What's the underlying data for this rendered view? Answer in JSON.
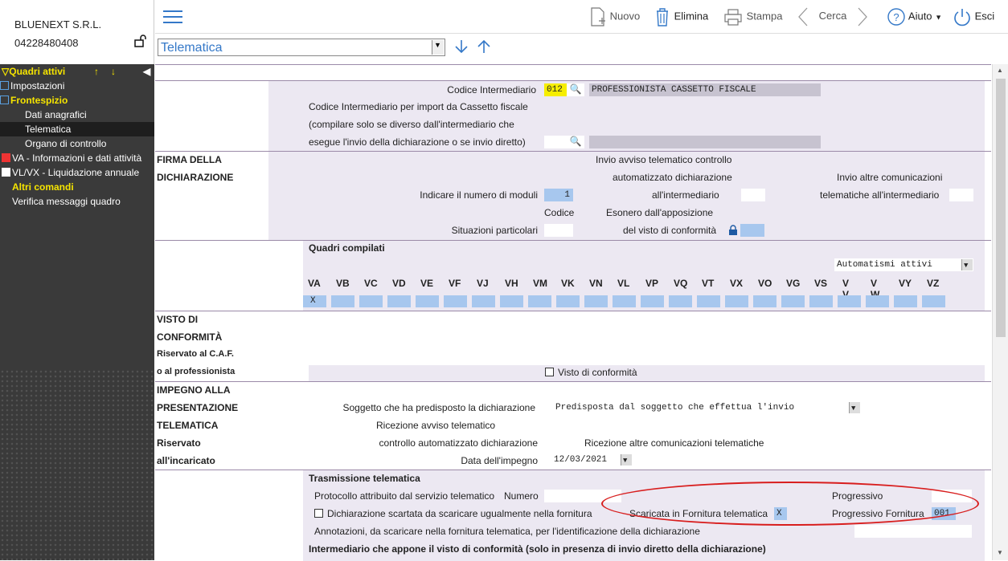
{
  "company": {
    "name": "BLUENEXT S.R.L.",
    "vat": "04228480408"
  },
  "toolbar": {
    "nuovo": "Nuovo",
    "elimina": "Elimina",
    "stampa": "Stampa",
    "cerca": "Cerca",
    "aiuto": "Aiuto",
    "esci": "Esci"
  },
  "combo": {
    "value": "Telematica"
  },
  "sidebar": {
    "header": "Quadri attivi",
    "items": [
      {
        "label": "Impostazioni"
      },
      {
        "label": "Frontespizio"
      },
      {
        "label": "Dati anagrafici"
      },
      {
        "label": "Telematica"
      },
      {
        "label": "Organo di controllo"
      },
      {
        "label": "VA - Informazioni e dati attività"
      },
      {
        "label": "VL/VX - Liquidazione annuale"
      }
    ],
    "altri": "Altri comandi",
    "verifica": "Verifica messaggi quadro"
  },
  "intermediario": {
    "codice_label": "Codice Intermediario",
    "codice_value": "012",
    "codice_desc": "PROFESSIONISTA CASSETTO FISCALE",
    "import_l1": "Codice Intermediario per import da Cassetto fiscale",
    "import_l2": "(compilare solo se diverso dall'intermediario che",
    "import_l3": "esegue l'invio della dichiarazione o se invio diretto)"
  },
  "firma": {
    "title1": "FIRMA DELLA",
    "title2": "DICHIARAZIONE",
    "moduli_label": "Indicare il numero di moduli",
    "moduli_value": "1",
    "codice": "Codice",
    "situazioni": "Situazioni particolari",
    "avviso1": "Invio avviso telematico controllo",
    "avviso2": "automatizzato dichiarazione",
    "avviso3": "all'intermediario",
    "esonero1": "Esonero dall'apposizione",
    "esonero2": "del visto di conformità",
    "altre1": "Invio altre comunicazioni",
    "altre2": "telematiche all'intermediario"
  },
  "quadri": {
    "title": "Quadri compilati",
    "automatismi": "Automatismi attivi",
    "codes": [
      "VA",
      "VB",
      "VC",
      "VD",
      "VE",
      "VF",
      "VJ",
      "VH",
      "VM",
      "VK",
      "VN",
      "VL",
      "VP",
      "VQ",
      "VT",
      "VX",
      "VO",
      "VG",
      "VS",
      "V V",
      "V W",
      "VY",
      "VZ"
    ],
    "va_value": "X"
  },
  "visto": {
    "t1": "VISTO DI",
    "t2": "CONFORMITÀ",
    "t3": "Riservato al C.A.F.",
    "t4": "o al professionista",
    "checkbox": "Visto di conformità"
  },
  "impegno": {
    "t1": "IMPEGNO ALLA",
    "t2": "PRESENTAZIONE",
    "t3": "TELEMATICA",
    "t4": "Riservato",
    "t5": "all'incaricato",
    "soggetto_label": "Soggetto che ha predisposto la dichiarazione",
    "soggetto_value": "Predisposta dal soggetto che effettua l'invio",
    "ricezione1": "Ricezione avviso telematico",
    "ricezione2": "controllo automatizzato dichiarazione",
    "ricezione_altre": "Ricezione altre comunicazioni telematiche",
    "data_label": "Data dell'impegno",
    "data_value": "12/03/2021"
  },
  "trasmissione": {
    "title": "Trasmissione telematica",
    "protocollo": "Protocollo attribuito dal servizio telematico",
    "numero": "Numero",
    "progressivo": "Progressivo",
    "scartata": "Dichiarazione scartata da scaricare ugualmente nella fornitura",
    "scaricata": "Scaricata in Fornitura telematica",
    "scaricata_value": "X",
    "prog_fornitura": "Progressivo Fornitura",
    "prog_fornitura_value": "001",
    "annotazioni": "Annotazioni, da scaricare nella fornitura telematica, per l'identificazione della dichiarazione",
    "intermediario_visto": "Intermediario che appone il visto di conformità (solo in presenza di invio diretto della dichiarazione)"
  }
}
